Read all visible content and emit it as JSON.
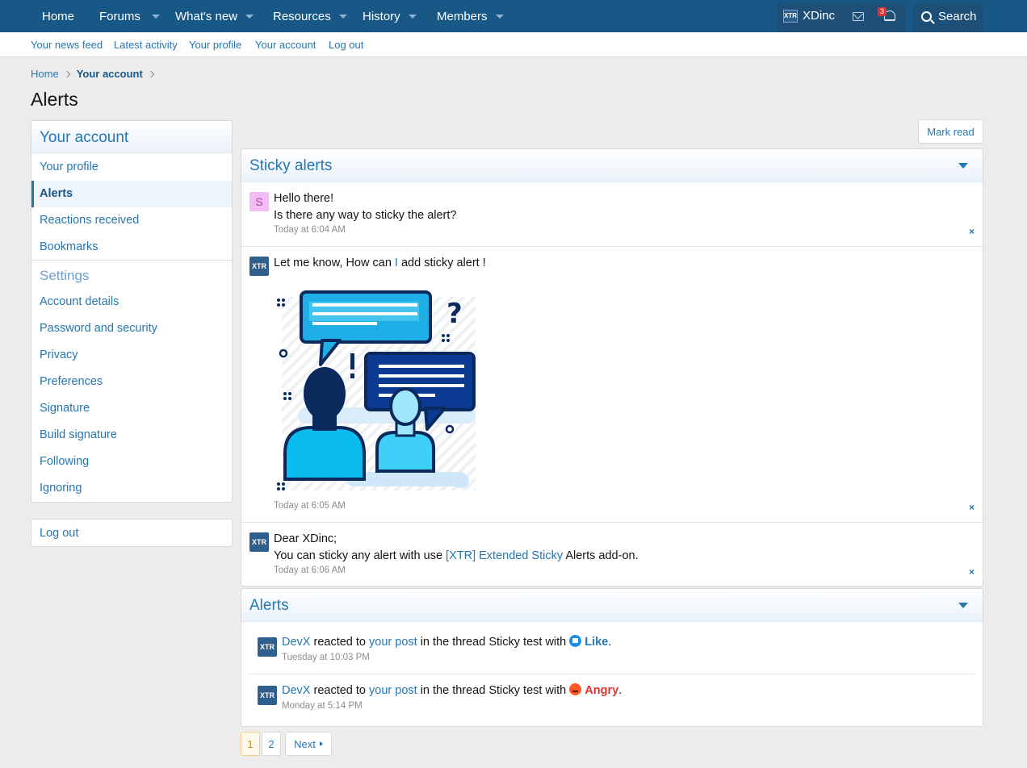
{
  "nav": {
    "home": "Home",
    "forums": "Forums",
    "whats_new": "What's new",
    "resources": "Resources",
    "history": "History",
    "members": "Members",
    "username": "XDinc",
    "alert_count": "3",
    "search": "Search",
    "logo_text": "XTR"
  },
  "subnav": {
    "news_feed": "Your news feed",
    "latest_activity": "Latest activity",
    "your_profile": "Your profile",
    "your_account": "Your account",
    "log_out": "Log out"
  },
  "breadcrumb": {
    "home": "Home",
    "current": "Your account"
  },
  "page_title": "Alerts",
  "sidebar": {
    "title": "Your account",
    "items": [
      "Your profile",
      "Alerts",
      "Reactions received",
      "Bookmarks"
    ],
    "settings_title": "Settings",
    "settings_items": [
      "Account details",
      "Password and security",
      "Privacy",
      "Preferences",
      "Signature",
      "Build signature",
      "Following",
      "Ignoring"
    ],
    "logout": "Log out"
  },
  "mark_read": "Mark read",
  "sticky": {
    "title": "Sticky alerts",
    "a1_avatar": "S",
    "a1_line1": "Hello there!",
    "a1_line2": "Is there any way to sticky the alert?",
    "a1_time": "Today at 6:04 AM",
    "a2_before": "Let me know, How can ",
    "a2_link": "I",
    "a2_after": " add sticky alert !",
    "a2_time": "Today at 6:05 AM",
    "a3_line1": "Dear XDinc;",
    "a3_before": "You can sticky any alert with use ",
    "a3_link": "[XTR] Extended Sticky",
    "a3_after": " Alerts add-on.",
    "a3_time": "Today at 6:06 AM",
    "close": "×"
  },
  "alerts": {
    "title": "Alerts",
    "items": [
      {
        "user": "DevX",
        "t1": " reacted to ",
        "post": "your post",
        "t2": " in the thread Sticky test with ",
        "reaction": "Like",
        "end": ".",
        "time": "Tuesday at 10:03 PM"
      },
      {
        "user": "DevX",
        "t1": " reacted to ",
        "post": "your post",
        "t2": " in the thread Sticky test with ",
        "reaction": "Angry",
        "end": ".",
        "time": "Monday at 5:14 PM"
      }
    ]
  },
  "pagination": {
    "p1": "1",
    "p2": "2",
    "next": "Next"
  },
  "colors": {
    "nav_bg": "#185886",
    "link": "#2577b1",
    "angry": "#e03030",
    "badge": "#e03030"
  }
}
